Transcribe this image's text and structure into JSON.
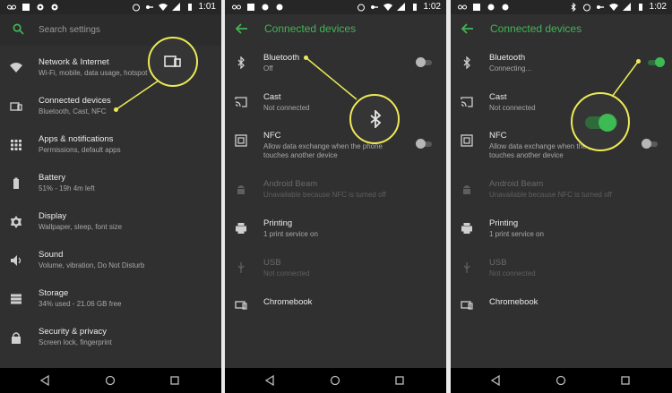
{
  "status_time_1": "1:01",
  "status_time_2": "1:02",
  "status_time_3": "1:02",
  "settings": {
    "search_placeholder": "Search settings",
    "items": [
      {
        "title": "Network & Internet",
        "subtitle": "Wi-Fi, mobile, data usage, hotspot",
        "icon": "wifi-icon"
      },
      {
        "title": "Connected devices",
        "subtitle": "Bluetooth, Cast, NFC",
        "icon": "connected-devices-icon"
      },
      {
        "title": "Apps & notifications",
        "subtitle": "Permissions, default apps",
        "icon": "apps-grid-icon"
      },
      {
        "title": "Battery",
        "subtitle": "51% - 19h 4m left",
        "icon": "battery-icon"
      },
      {
        "title": "Display",
        "subtitle": "Wallpaper, sleep, font size",
        "icon": "brightness-icon"
      },
      {
        "title": "Sound",
        "subtitle": "Volume, vibration, Do Not Disturb",
        "icon": "volume-icon"
      },
      {
        "title": "Storage",
        "subtitle": "34% used - 21.06 GB free",
        "icon": "storage-icon"
      },
      {
        "title": "Security & privacy",
        "subtitle": "Screen lock, fingerprint",
        "icon": "lock-icon"
      }
    ]
  },
  "connected": {
    "title": "Connected devices",
    "items_off": [
      {
        "title": "Bluetooth",
        "subtitle": "Off"
      },
      {
        "title": "Cast",
        "subtitle": "Not connected"
      },
      {
        "title": "NFC",
        "subtitle": "Allow data exchange when the phone",
        "subtitle2": "touches another device"
      },
      {
        "title": "Android Beam",
        "subtitle": "Unavailable because NFC is turned off"
      },
      {
        "title": "Printing",
        "subtitle": "1 print service on"
      },
      {
        "title": "USB",
        "subtitle": "Not connected"
      },
      {
        "title": "Chromebook",
        "subtitle": ""
      }
    ],
    "bluetooth_connecting": "Connecting..."
  },
  "colors": {
    "accent": "#41b554",
    "callout": "#ecea57",
    "background": "#303030"
  }
}
